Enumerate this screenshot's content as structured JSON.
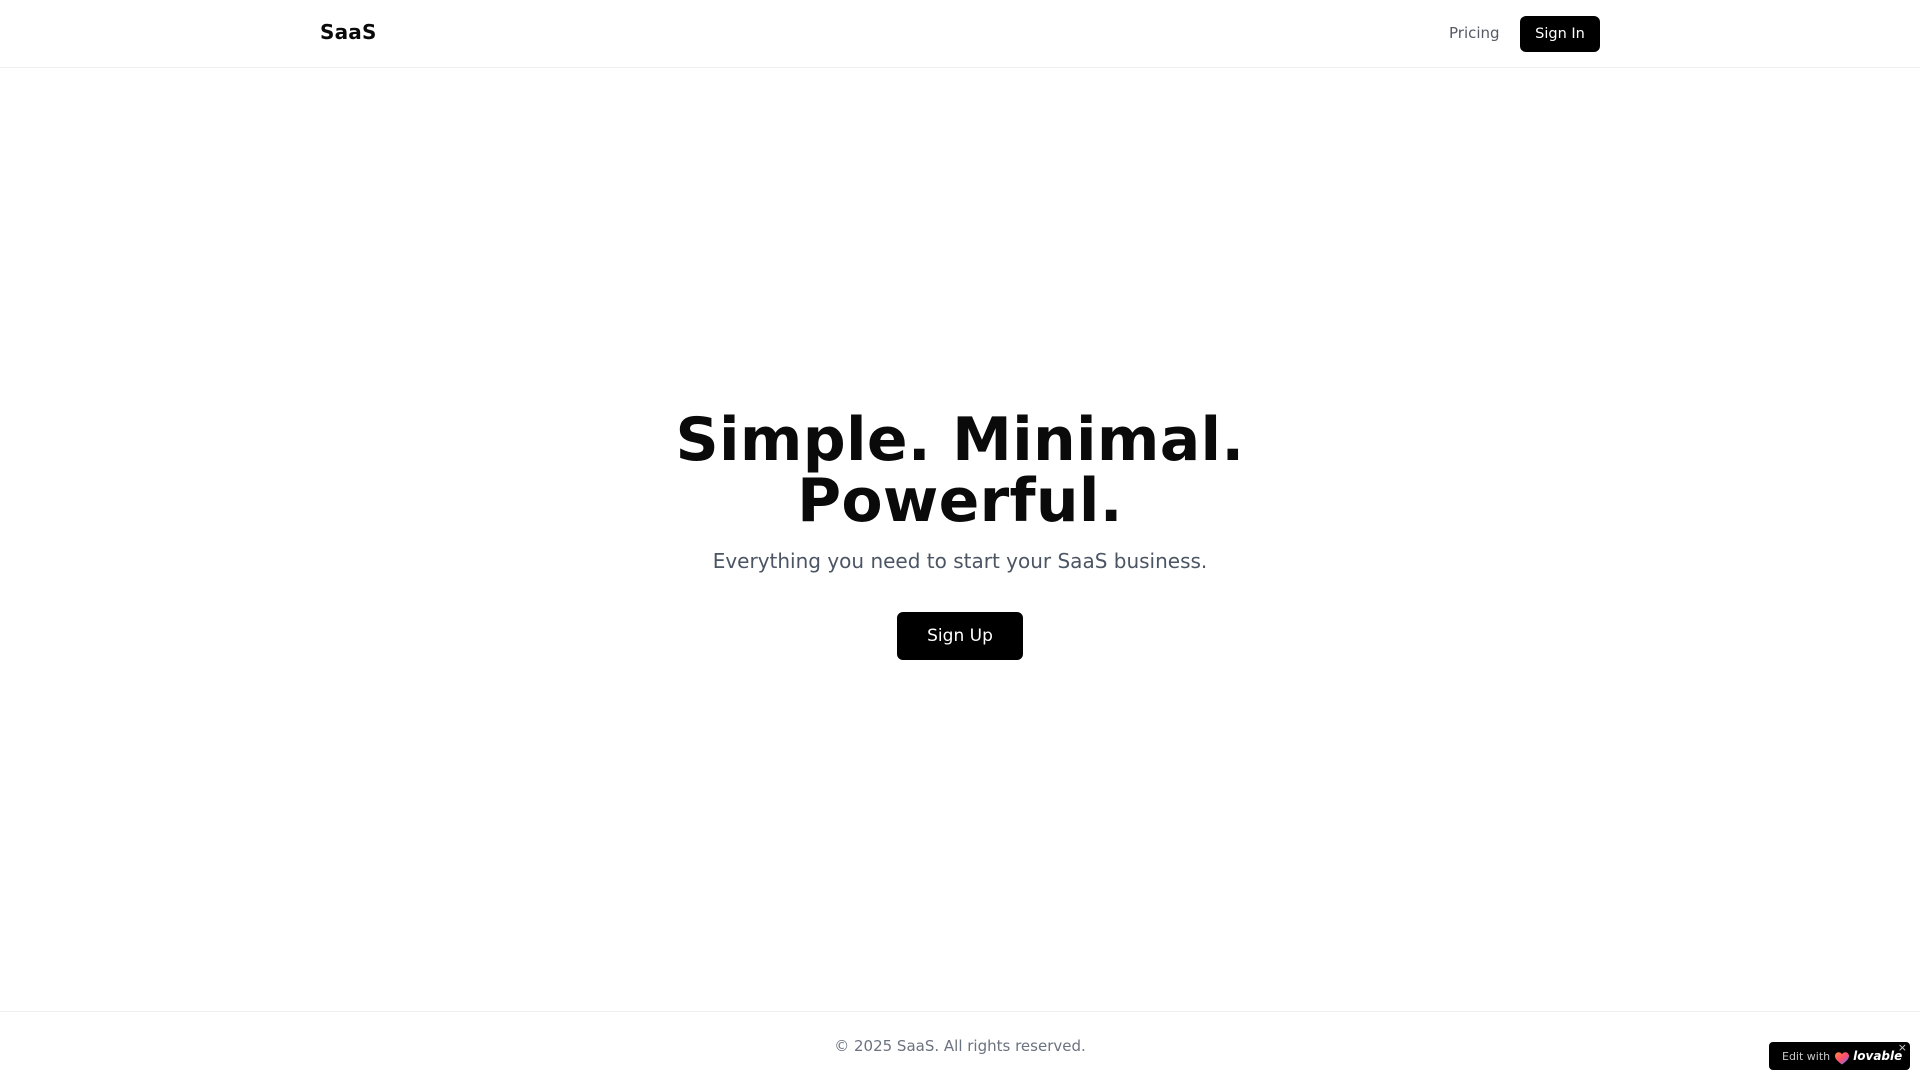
{
  "header": {
    "brand": "SaaS",
    "nav_pricing": "Pricing",
    "signin_label": "Sign In"
  },
  "hero": {
    "title_line1": "Simple. Minimal.",
    "title_line2": "Powerful.",
    "subtitle": "Everything you need to start your SaaS business.",
    "signup_label": "Sign Up"
  },
  "footer": {
    "copyright": "© 2025 SaaS. All rights reserved."
  },
  "badge": {
    "prefix": "Edit with",
    "brand": "lovable",
    "icon": "lovable-heart-icon",
    "close": "×"
  },
  "colors": {
    "primary": "#000000",
    "text": "#0a0a0a",
    "muted": "#6b7280",
    "background": "#ffffff"
  }
}
